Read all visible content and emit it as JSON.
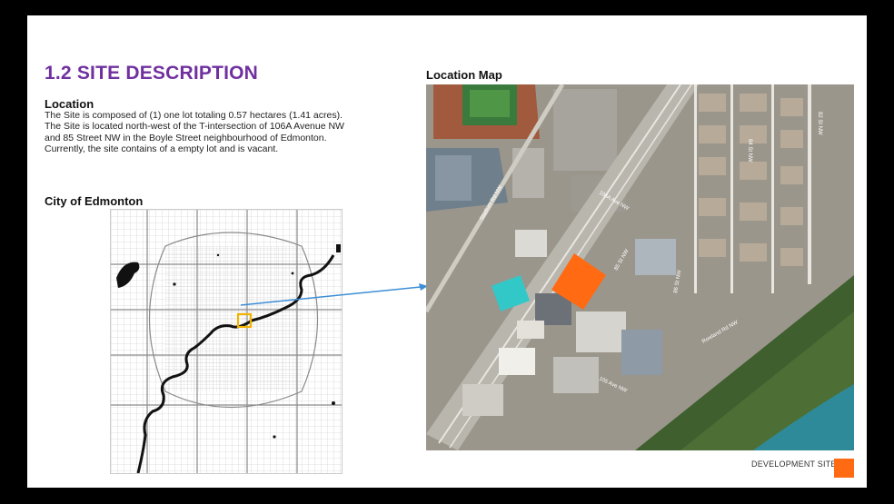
{
  "title": "1.2 SITE DESCRIPTION",
  "location": {
    "heading": "Location",
    "text": "The Site is composed of (1) one lot totaling 0.57 hectares (1.41 acres). The Site is located north-west of the T-intersection of 106A Avenue NW and  85 Street NW in the Boyle Street neighbourhood of Edmonton. Currently, the site contains of a empty lot and is vacant."
  },
  "city": {
    "heading": "City of Edmonton"
  },
  "location_map": {
    "heading": "Location Map",
    "street_labels": [
      "Stadium Rd NW",
      "106A Ave NW",
      "85 St NW",
      "84 St NW",
      "82 St NW",
      "86 St NW",
      "Rowland Rd NW",
      "105 Ave NW"
    ]
  },
  "legend": {
    "label": "DEVELOPMENT SITE"
  },
  "colors": {
    "title": "#7030a0",
    "site": "#ff6a13",
    "highlight": "#f2b200",
    "arrow": "#3d8ed6",
    "river": "#111111"
  }
}
